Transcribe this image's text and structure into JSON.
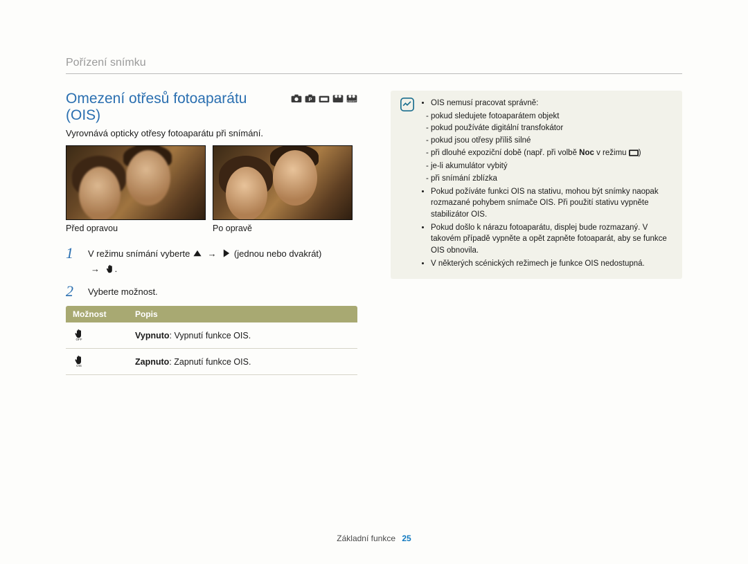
{
  "section_header": "Pořízení snímku",
  "title": "Omezení otřesů fotoaparátu (OIS)",
  "subtitle": "Vyrovnává opticky otřesy fotoaparátu při snímání.",
  "photos": {
    "before": "Před opravou",
    "after": "Po opravě"
  },
  "steps": {
    "s1_a": "V režimu snímání vyberte",
    "s1_b": "(jednou nebo dvakrát)",
    "s2": "Vyberte možnost."
  },
  "table": {
    "h_option": "Možnost",
    "h_desc": "Popis",
    "row1_bold": "Vypnuto",
    "row1_rest": ": Vypnutí funkce OIS.",
    "row2_bold": "Zapnuto",
    "row2_rest": ": Zapnutí funkce OIS."
  },
  "note": {
    "l0": "OIS nemusí pracovat správně:",
    "s1": "pokud sledujete fotoaparátem objekt",
    "s2": "pokud používáte digitální transfokátor",
    "s3": "pokud jsou otřesy příliš silné",
    "s4a": "při dlouhé expoziční době (např. při volbě ",
    "s4b": "Noc",
    "s4c": " v režimu ",
    "s4d": ")",
    "s5": "je-li akumulátor vybitý",
    "s6": "při snímání zblízka",
    "l1": "Pokud požíváte funkci OIS na stativu, mohou být snímky naopak rozmazané pohybem snímače OIS. Při použití stativu vypněte stabilizátor OIS.",
    "l2": "Pokud došlo k nárazu fotoaparátu, displej bude rozmazaný. V takovém případě vypněte a opět zapněte fotoaparát, aby se funkce OIS obnovila.",
    "l3": "V některých scénických režimech je funkce OIS nedostupná."
  },
  "footer": {
    "label": "Základní funkce",
    "page": "25"
  }
}
